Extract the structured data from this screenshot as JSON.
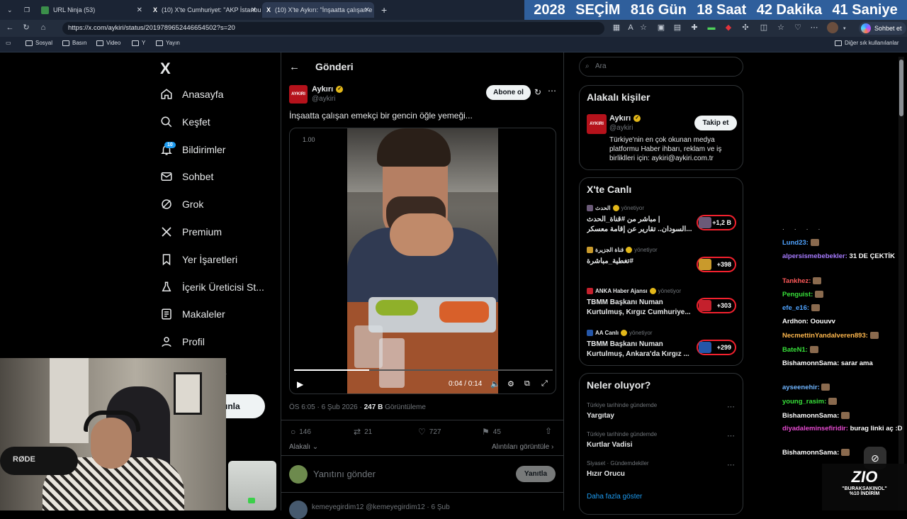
{
  "browser": {
    "tabs": [
      {
        "title": "URL Ninja (53)"
      },
      {
        "title": "(10) X'te Cumhuriyet: \"AKP İstanbu"
      },
      {
        "title": "(10) X'te Aykırı: \"İnşaatta çalışan e"
      }
    ],
    "new_tab": "+",
    "url": "https://x.com/aykiri/status/2019789652446654502?s=20",
    "profile_label": "Sohbet et",
    "bookmarks": [
      "Sosyal",
      "Basın",
      "Video",
      "Y",
      "Yayın"
    ],
    "other_bookmarks": "Diğer sık kullanılanlar"
  },
  "countdown": {
    "year": "2028",
    "label": "SEÇİM",
    "days": "816 Gün",
    "hours": "18 Saat",
    "minutes": "42 Dakika",
    "seconds": "41 Saniye"
  },
  "nav": {
    "logo": "X",
    "items": [
      {
        "label": "Anasayfa",
        "icon": "home-icon"
      },
      {
        "label": "Keşfet",
        "icon": "search-icon"
      },
      {
        "label": "Bildirimler",
        "icon": "bell-icon",
        "badge": "10"
      },
      {
        "label": "Sohbet",
        "icon": "mail-icon"
      },
      {
        "label": "Grok",
        "icon": "grok-icon"
      },
      {
        "label": "Premium",
        "icon": "x-icon"
      },
      {
        "label": "Yer İşaretleri",
        "icon": "bookmark-icon"
      },
      {
        "label": "İçerik Üreticisi St...",
        "icon": "flask-icon"
      },
      {
        "label": "Makaleler",
        "icon": "article-icon"
      },
      {
        "label": "Profil",
        "icon": "person-icon"
      }
    ],
    "more_partial": "a",
    "post_button_partial": "ınla"
  },
  "post": {
    "header": "Gönderi",
    "author_name": "Aykırı",
    "author_handle": "@aykiri",
    "avatar_text": "AYKIRI",
    "subscribe": "Abone ol",
    "text": "İnşaatta çalışan emekçi bir gencin öğle yemeği...",
    "video": {
      "speed": "1.00",
      "time": "0:04 / 0:14",
      "progress": 0.29
    },
    "meta_time": "ÖS 6:05 · 6 Şub 2026 · ",
    "views": "247 B",
    "views_label": " Görüntüleme",
    "stats": {
      "replies": "146",
      "reposts": "21",
      "likes": "727",
      "bookmarks": "45"
    },
    "relevant": "Alakalı",
    "quotes": "Alıntıları görüntüle",
    "reply_placeholder": "Yanıtını gönder",
    "reply_button": "Yanıtla",
    "next_reply_partial": "kemeyegirdim12  @kemeyegirdim12 · 6 Şub"
  },
  "sidebar": {
    "search_placeholder": "Ara",
    "related": {
      "title": "Alakalı kişiler",
      "name": "Aykırı",
      "handle": "@aykiri",
      "follow": "Takip et",
      "bio": "Türkiye'nin en çok okunan medya platformu Haber ihbarı, reklam ve iş birliklleri için: aykiri@aykiri.com.tr"
    },
    "live": {
      "title": "X'te Canlı",
      "items": [
        {
          "source": "الحدث",
          "status": "yönetiyor",
          "text1": "مباشر من #قناة_الحدث |",
          "text2": "السودان.. تقارير عن إقامة معسكر...",
          "count": "+1,2 B",
          "thumb": "#6b5a78"
        },
        {
          "source": "قناة الجزيرة",
          "status": "yönetiyor",
          "text1": "تغطية_مباشرة#",
          "text2": "",
          "count": "+398",
          "thumb": "#c99a2c"
        },
        {
          "source": "ANKA Haber Ajansı",
          "status": "yönetiyor",
          "text1": "TBMM Başkanı Numan",
          "text2": "Kurtulmuş, Kırgız Cumhuriye...",
          "count": "+303",
          "thumb": "#c4202c"
        },
        {
          "source": "AA Canlı",
          "status": "yönetiyor",
          "text1": "TBMM Başkanı Numan",
          "text2": "Kurtulmuş, Ankara'da Kırgız ...",
          "count": "+299",
          "thumb": "#2456a8"
        }
      ]
    },
    "trends": {
      "title": "Neler oluyor?",
      "items": [
        {
          "context": "Türkiye tarihinde gündemde",
          "name": "Yargıtay"
        },
        {
          "context": "Türkiye tarihinde gündemde",
          "name": "Kurtlar Vadisi"
        },
        {
          "context": "Siyaset · Gündemdekiler",
          "name": "Hızır Orucu"
        }
      ],
      "more": "Daha fazla göster"
    }
  },
  "chat": [
    {
      "user": "Lund23:",
      "msg": "",
      "color": "#4fa3ff"
    },
    {
      "user": "alpersismebebekler:",
      "msg": "31 DE ÇEKTİK",
      "color": "#a77bff"
    },
    {
      "user": "Tankhez:",
      "msg": "",
      "color": "#ff5a5a"
    },
    {
      "user": "Penguist:",
      "msg": "",
      "color": "#38e03a"
    },
    {
      "user": "efe_e16:",
      "msg": "",
      "color": "#4fa3ff"
    },
    {
      "user": "Ardhon:",
      "msg": "Oouuvv",
      "color": "#ffffff"
    },
    {
      "user": "NecmettinYandalveren893:",
      "msg": "",
      "color": "#ffb84d"
    },
    {
      "user": "BateN1:",
      "msg": "",
      "color": "#38e03a"
    },
    {
      "user": "BishamonnSama:",
      "msg": "sarar ama",
      "color": "#ffffff"
    },
    {
      "user": "ayseenehir:",
      "msg": "",
      "color": "#6fb5ff"
    },
    {
      "user": "young_rasim:",
      "msg": "",
      "color": "#38e03a"
    },
    {
      "user": "BishamonnSama:",
      "msg": "",
      "color": "#ffffff"
    },
    {
      "user": "diyadaleminsefiridir:",
      "msg": "burag linki aç :D",
      "color": "#e64ad0"
    },
    {
      "user": "BishamonnSama:",
      "msg": "",
      "color": "#ffffff"
    }
  ],
  "sponsor": {
    "brand": "ZIO",
    "line1": "\"BURAKSAKINOL\"",
    "line2": "%10 İNDİRİM"
  },
  "webcam": {
    "mic_brand": "RØDE"
  }
}
